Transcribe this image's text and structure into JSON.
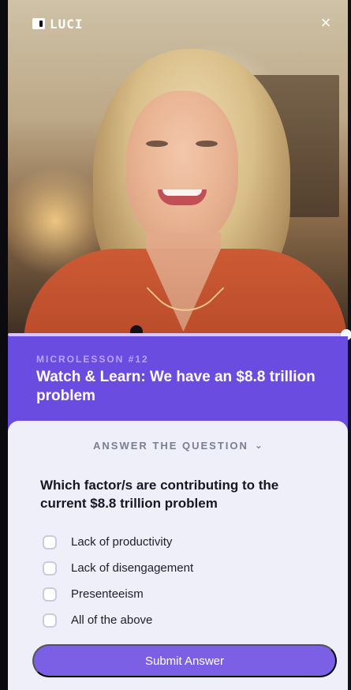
{
  "brand": {
    "logo_text": "LUCI"
  },
  "header": {
    "close_icon": "close-icon"
  },
  "video": {
    "progress": 1.0
  },
  "lesson": {
    "kicker": "MICROLESSON #12",
    "title": "Watch & Learn: We have an $8.8 trillion problem"
  },
  "answer_panel": {
    "toggle_label": "ANSWER THE QUESTION",
    "toggle_icon": "chevron-down-icon",
    "question": "Which factor/s are contributing to the current $8.8 trillion problem",
    "options": [
      {
        "label": "Lack of productivity"
      },
      {
        "label": "Lack of disengagement"
      },
      {
        "label": "Presenteeism"
      },
      {
        "label": "All of the above"
      }
    ],
    "submit_label": "Submit Answer"
  },
  "colors": {
    "purple_header": "#6a4ce0",
    "purple_button": "#7b60e6",
    "card_bg": "#eeeff9"
  }
}
